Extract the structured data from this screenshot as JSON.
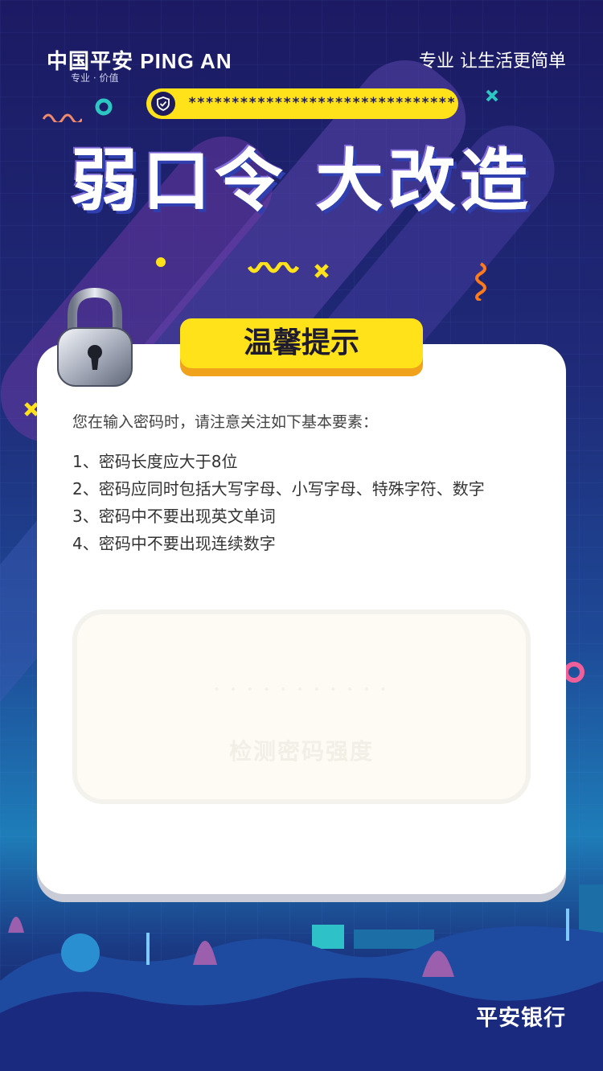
{
  "header": {
    "logo_text": "中国平安 PING AN",
    "logo_subtitle": "专业 · 价值",
    "slogan": "专业 让生活更简单"
  },
  "password_bar": {
    "masked_value": "*******************************"
  },
  "headline": "弱口令 大改造",
  "tip_card": {
    "title": "温馨提示",
    "intro": "您在输入密码时，请注意关注如下基本要素：",
    "rules": [
      "1、密码长度应大于8位",
      "2、密码应同时包括大写字母、小写字母、特殊字符、数字",
      "3、密码中不要出现英文单词",
      "4、密码中不要出现连续数字"
    ],
    "check_dots": "• • • • • • • • • • •",
    "check_button_label": "检测密码强度"
  },
  "footer": {
    "brand": "平安银行"
  },
  "colors": {
    "accent_yellow": "#ffe21a",
    "tab_shadow_orange": "#f0a21a",
    "background_navy": "#1c1a63",
    "text_dark": "#333333"
  },
  "icons": [
    "shield-check-icon",
    "padlock-icon"
  ]
}
